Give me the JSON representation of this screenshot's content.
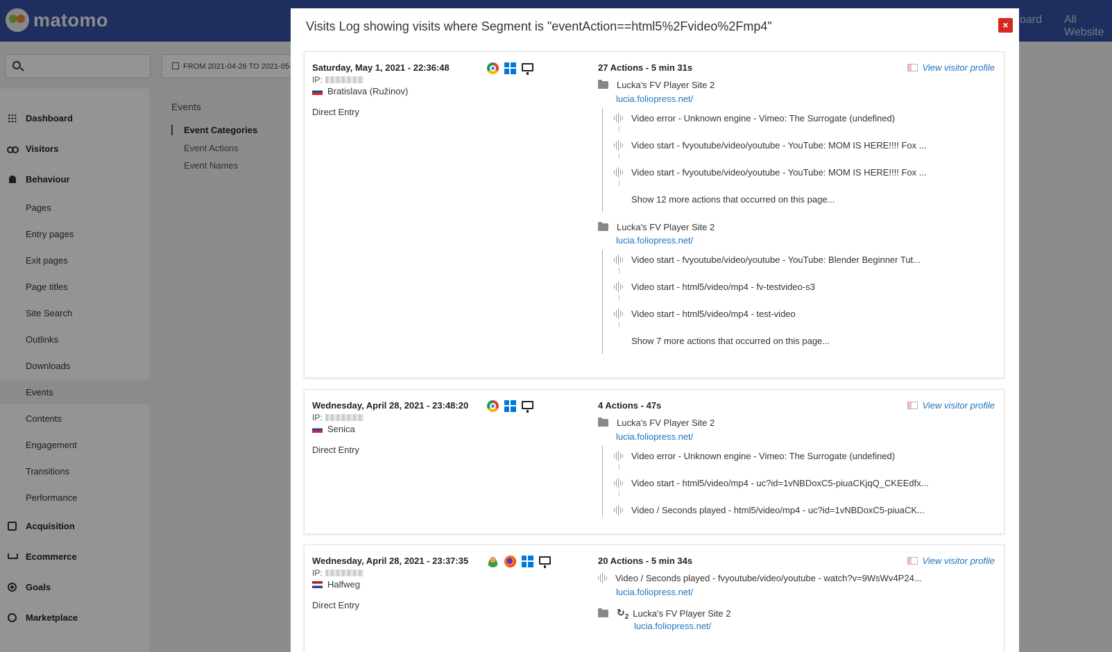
{
  "app": {
    "logo_text": "matomo",
    "top_links": [
      "oard",
      "All Website"
    ]
  },
  "search": {
    "placeholder": ""
  },
  "date_range": "FROM 2021-04-26 TO 2021-05-0",
  "sidebar": {
    "items": [
      {
        "label": "Dashboard",
        "kind": "main",
        "icon": "grid-icon"
      },
      {
        "label": "Visitors",
        "kind": "main",
        "icon": "binoculars-icon"
      },
      {
        "label": "Behaviour",
        "kind": "main",
        "icon": "bell-icon"
      },
      {
        "label": "Pages",
        "kind": "sub"
      },
      {
        "label": "Entry pages",
        "kind": "sub"
      },
      {
        "label": "Exit pages",
        "kind": "sub"
      },
      {
        "label": "Page titles",
        "kind": "sub"
      },
      {
        "label": "Site Search",
        "kind": "sub"
      },
      {
        "label": "Outlinks",
        "kind": "sub"
      },
      {
        "label": "Downloads",
        "kind": "sub"
      },
      {
        "label": "Events",
        "kind": "sub",
        "active": true
      },
      {
        "label": "Contents",
        "kind": "sub"
      },
      {
        "label": "Engagement",
        "kind": "sub"
      },
      {
        "label": "Transitions",
        "kind": "sub"
      },
      {
        "label": "Performance",
        "kind": "sub"
      },
      {
        "label": "Acquisition",
        "kind": "main",
        "icon": "box-icon"
      },
      {
        "label": "Ecommerce",
        "kind": "main",
        "icon": "cart-icon"
      },
      {
        "label": "Goals",
        "kind": "main",
        "icon": "target-icon"
      },
      {
        "label": "Marketplace",
        "kind": "main",
        "icon": "headset-icon"
      }
    ]
  },
  "events_panel": {
    "title": "Events",
    "items": [
      "Event Categories",
      "Event Actions",
      "Event Names"
    ]
  },
  "modal": {
    "title": "Visits Log showing visits where Segment is \"eventAction==html5%2Fvideo%2Fmp4\"",
    "close_label": "×",
    "profile_label": "View visitor profile",
    "ip_label": "IP:",
    "visits": [
      {
        "date": "Saturday, May 1, 2021 - 22:36:48",
        "location": "Bratislava (Ružinov)",
        "referrer": "Direct Entry",
        "actions": "27 Actions - 5 min 31s",
        "page_title": "Lucka's FV Player Site 2",
        "page_url": "lucia.foliopress.net/",
        "events_1": [
          "Video error - Unknown engine - Vimeo: The Surrogate (undefined)",
          "Video start - fvyoutube/video/youtube - YouTube: MOM IS HERE!!!! Fox ...",
          "Video start - fvyoutube/video/youtube - YouTube: MOM IS HERE!!!! Fox ..."
        ],
        "more_1": "Show 12 more actions that occurred on this page...",
        "events_2": [
          "Video start - fvyoutube/video/youtube - YouTube: Blender Beginner Tut...",
          "Video start - html5/video/mp4 - fv-testvideo-s3",
          "Video start - html5/video/mp4 - test-video"
        ],
        "more_2": "Show 7 more actions that occurred on this page..."
      },
      {
        "date": "Wednesday, April 28, 2021 - 23:48:20",
        "location": "Senica",
        "referrer": "Direct Entry",
        "actions": "4 Actions - 47s",
        "page_title": "Lucka's FV Player Site 2",
        "page_url": "lucia.foliopress.net/",
        "events_1": [
          "Video error - Unknown engine - Vimeo: The Surrogate (undefined)",
          "Video start - html5/video/mp4 - uc?id=1vNBDoxC5-piuaCKjqQ_CKEEdfx...",
          "Video / Seconds played - html5/video/mp4 - uc?id=1vNBDoxC5-piuaCK..."
        ]
      },
      {
        "date": "Wednesday, April 28, 2021 - 23:37:35",
        "location": "Halfweg",
        "referrer": "Direct Entry",
        "actions": "20 Actions - 5 min 34s",
        "first_event": "Video / Seconds played - fvyoutube/video/youtube - watch?v=9WsWv4P24...",
        "first_url": "lucia.foliopress.net/",
        "reload_count": "2",
        "page_title": "Lucka's FV Player Site 2",
        "page_url": "lucia.foliopress.net/"
      }
    ]
  }
}
